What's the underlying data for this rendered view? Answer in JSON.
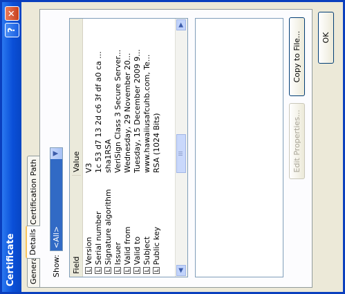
{
  "window": {
    "title": "Certificate",
    "help_label": "?",
    "close_label": "✕"
  },
  "tabs": [
    {
      "label": "General"
    },
    {
      "label": "Details",
      "active": true
    },
    {
      "label": "Certification Path"
    }
  ],
  "show": {
    "label": "Show:",
    "value": "<All>"
  },
  "table": {
    "columns": [
      "Field",
      "Value"
    ],
    "rows": [
      {
        "field": "Version",
        "value": "V3"
      },
      {
        "field": "Serial number",
        "value": "1c 53 d7 13 2d c6 3f df a0 ca ..."
      },
      {
        "field": "Signature algorithm",
        "value": "sha1RSA"
      },
      {
        "field": "Issuer",
        "value": "VeriSign Class 3 Secure Server..."
      },
      {
        "field": "Valid from",
        "value": "Wednesday, 29 November 20..."
      },
      {
        "field": "Valid to",
        "value": "Tuesday, 15 December 2009 9..."
      },
      {
        "field": "Subject",
        "value": "www.hawaiiusafcuhb.com, Te..."
      },
      {
        "field": "Public key",
        "value": "RSA (1024 Bits)"
      }
    ],
    "scroll_thumb_label": "III"
  },
  "buttons": {
    "edit_properties": "Edit Properties...",
    "copy_to_file": "Copy to File...",
    "ok": "OK"
  },
  "icons": {
    "row_icon": "certificate-field-icon"
  },
  "colors": {
    "titlebar": "#0a4fd8",
    "selection": "#316ac5",
    "close": "#d5532b"
  }
}
